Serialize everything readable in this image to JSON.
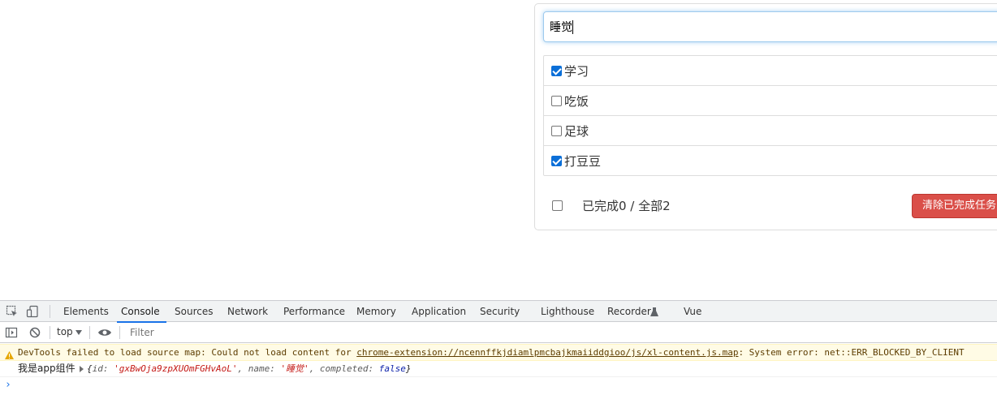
{
  "todo": {
    "input_value": "睡觉",
    "items": [
      {
        "label": "学习",
        "done": true
      },
      {
        "label": "吃饭",
        "done": false
      },
      {
        "label": "足球",
        "done": false
      },
      {
        "label": "打豆豆",
        "done": true
      }
    ],
    "footer": {
      "status_text": "已完成0 / 全部2",
      "clear_button_label": "清除已完成任务"
    }
  },
  "devtools": {
    "tabs": [
      "Elements",
      "Console",
      "Sources",
      "Network",
      "Performance",
      "Memory",
      "Application",
      "Security",
      "Lighthouse",
      "Recorder",
      "Vue"
    ],
    "active_tab": "Console",
    "context": "top",
    "filter_placeholder": "Filter",
    "warning": {
      "prefix": "DevTools failed to load source map: Could not load content for ",
      "url": "chrome-extension://ncennffkjdiamlpmcbajkmaiiddgioo/js/xl-content.js.map",
      "suffix": ": System error: net::ERR_BLOCKED_BY_CLIENT"
    },
    "log": {
      "label": "我是app组件",
      "open": "{",
      "id_key": "id: ",
      "id_value": "'gxBwOja9zpXUOmFGHvAoL'",
      "name_key": ", name: ",
      "name_value": "'睡觉'",
      "completed_key": ", completed: ",
      "completed_value": "false",
      "close": "}"
    },
    "prompt": "›"
  },
  "colors": {
    "accent": "#1a73e8",
    "danger": "#da4f49",
    "warning_bg": "#fffbe5"
  }
}
